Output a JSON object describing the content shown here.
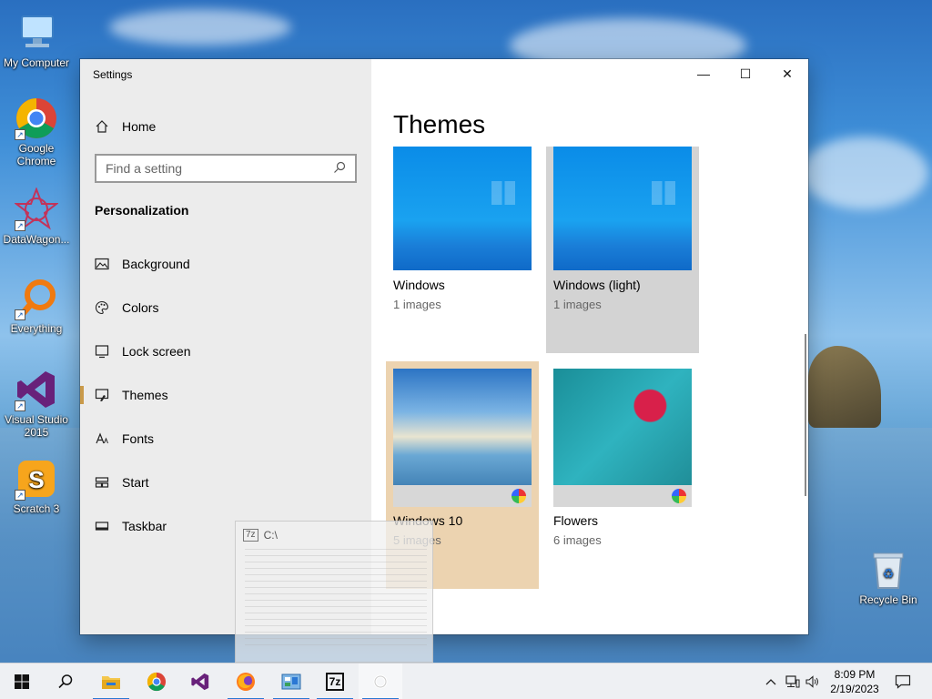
{
  "desktop": {
    "icons": [
      {
        "label": "My Computer"
      },
      {
        "label": "Google Chrome"
      },
      {
        "label": "DataWagon..."
      },
      {
        "label": "Everything"
      },
      {
        "label": "Visual Studio 2015"
      },
      {
        "label": "Scratch 3"
      },
      {
        "label": "Recycle Bin"
      }
    ]
  },
  "window": {
    "title": "Settings",
    "controls": {
      "minimize": "—",
      "maximize": "☐",
      "close": "✕"
    }
  },
  "sidebar": {
    "home_label": "Home",
    "search_placeholder": "Find a setting",
    "section_title": "Personalization",
    "items": [
      {
        "label": "Background",
        "icon": "image-icon"
      },
      {
        "label": "Colors",
        "icon": "palette-icon"
      },
      {
        "label": "Lock screen",
        "icon": "lock-screen-icon"
      },
      {
        "label": "Themes",
        "icon": "brush-icon",
        "active": true
      },
      {
        "label": "Fonts",
        "icon": "font-icon"
      },
      {
        "label": "Start",
        "icon": "start-grid-icon"
      },
      {
        "label": "Taskbar",
        "icon": "taskbar-icon"
      }
    ]
  },
  "main": {
    "title": "Themes",
    "themes": [
      {
        "name": "Windows",
        "count": "1 images"
      },
      {
        "name": "Windows (light)",
        "count": "1 images"
      },
      {
        "name": "Windows 10",
        "count": "5 images"
      },
      {
        "name": "Flowers",
        "count": "6 images"
      }
    ]
  },
  "drag_ghost": {
    "app": "7z",
    "title": "C:\\"
  },
  "taskbar": {
    "time": "8:09 PM",
    "date": "2/19/2023"
  },
  "colors": {
    "accent": "#c99a4a",
    "taskbar_indicator": "#2b78d4"
  }
}
